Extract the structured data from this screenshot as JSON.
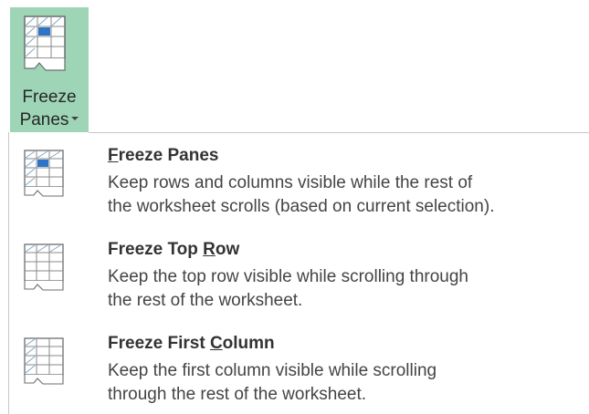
{
  "ribbon": {
    "button_label_line1": "Freeze",
    "button_label_line2": "Panes",
    "icon": "freeze-panes-icon",
    "highlight_color": "#9fd5b7"
  },
  "menu": {
    "items": [
      {
        "title_prefix": "",
        "title_accel": "F",
        "title_suffix": "reeze Panes",
        "description_line1": "Keep rows and columns visible while the rest of",
        "description_line2": "the worksheet scrolls (based on current selection).",
        "icon": "freeze-panes-icon"
      },
      {
        "title_prefix": "Freeze Top ",
        "title_accel": "R",
        "title_suffix": "ow",
        "description_line1": "Keep the top row visible while scrolling through",
        "description_line2": "the rest of the worksheet.",
        "icon": "freeze-top-row-icon"
      },
      {
        "title_prefix": "Freeze First ",
        "title_accel": "C",
        "title_suffix": "olumn",
        "description_line1": "Keep the first column visible while scrolling",
        "description_line2": "through the rest of the worksheet.",
        "icon": "freeze-first-column-icon"
      }
    ]
  }
}
